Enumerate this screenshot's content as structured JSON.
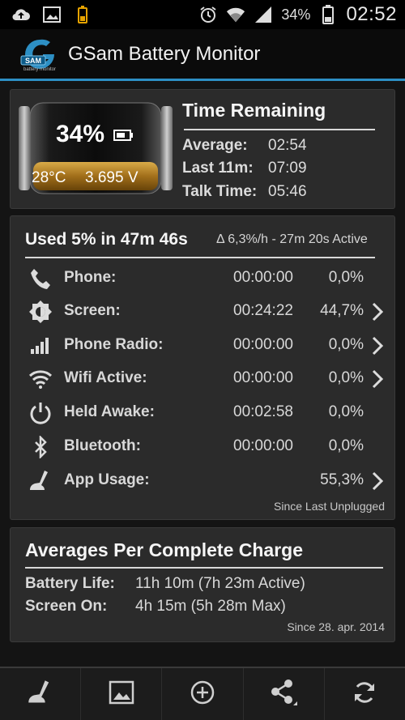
{
  "status_bar": {
    "battery_percent": "34%",
    "time": "02:52",
    "left_icons": [
      "cloud-upload-icon",
      "image-icon",
      "battery-small-icon"
    ],
    "right_icons": [
      "alarm-icon",
      "wifi-icon",
      "signal-icon"
    ]
  },
  "app_bar": {
    "title": "GSam Battery Monitor",
    "logo_text": "SAM",
    "logo_sub": "battery monitor"
  },
  "battery_panel": {
    "percent": "34%",
    "level": 0.34,
    "temperature": "28°C",
    "voltage": "3.695 V",
    "time_remaining_title": "Time Remaining",
    "rows": [
      {
        "label": "Average:",
        "value": "02:54"
      },
      {
        "label": "Last 11m:",
        "value": "07:09"
      },
      {
        "label": "Talk Time:",
        "value": "05:46"
      }
    ]
  },
  "usage_panel": {
    "title": "Used 5% in 47m 46s",
    "subtitle": "Δ 6,3%/h - 27m 20s Active",
    "rows": [
      {
        "icon": "phone-icon",
        "label": "Phone:",
        "time": "00:00:00",
        "percent": "0,0%",
        "chevron": false
      },
      {
        "icon": "brightness-icon",
        "label": "Screen:",
        "time": "00:24:22",
        "percent": "44,7%",
        "chevron": true
      },
      {
        "icon": "signal-bars-icon",
        "label": "Phone Radio:",
        "time": "00:00:00",
        "percent": "0,0%",
        "chevron": true
      },
      {
        "icon": "wifi-icon",
        "label": "Wifi Active:",
        "time": "00:00:00",
        "percent": "0,0%",
        "chevron": true
      },
      {
        "icon": "power-icon",
        "label": "Held Awake:",
        "time": "00:02:58",
        "percent": "0,0%",
        "chevron": false
      },
      {
        "icon": "bluetooth-icon",
        "label": "Bluetooth:",
        "time": "00:00:00",
        "percent": "0,0%",
        "chevron": false
      },
      {
        "icon": "app-usage-icon",
        "label": "App Usage:",
        "time": "",
        "percent": "55,3%",
        "chevron": true
      }
    ],
    "footer": "Since Last Unplugged"
  },
  "averages_panel": {
    "title": "Averages Per Complete Charge",
    "rows": [
      {
        "label": "Battery Life:",
        "value": "11h 10m (7h 23m Active)"
      },
      {
        "label": "Screen On:",
        "value": "4h 15m (5h 28m Max)"
      }
    ],
    "footer": "Since 28. apr. 2014"
  },
  "bottom_bar": {
    "buttons": [
      "app-usage-icon",
      "image-icon",
      "add-icon",
      "share-icon",
      "refresh-icon"
    ]
  },
  "colors": {
    "accent": "#2d8fc4",
    "panel_bg": "#2b2b2b",
    "page_bg": "#141414"
  }
}
